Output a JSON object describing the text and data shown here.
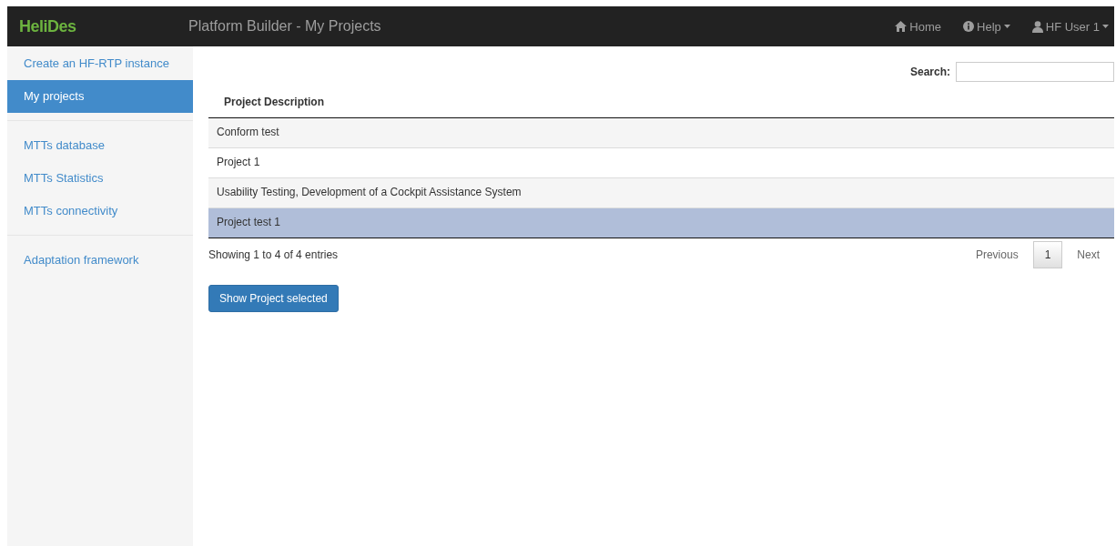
{
  "navbar": {
    "brand": "HeliDes",
    "title": "Platform Builder - My Projects",
    "links": [
      {
        "kind": "home",
        "label": "Home",
        "dropdown": false
      },
      {
        "kind": "help",
        "label": "Help",
        "dropdown": true
      },
      {
        "kind": "user",
        "label": "HF User 1",
        "dropdown": true
      }
    ]
  },
  "sidebar": {
    "groups": [
      [
        {
          "label": "Create an HF-RTP instance",
          "selected": false
        },
        {
          "label": "My projects",
          "selected": true
        }
      ],
      [
        {
          "label": "MTTs database",
          "selected": false
        },
        {
          "label": "MTTs Statistics",
          "selected": false
        },
        {
          "label": "MTTs connectivity",
          "selected": false
        }
      ],
      [
        {
          "label": "Adaptation framework",
          "selected": false
        }
      ]
    ]
  },
  "search": {
    "label": "Search:"
  },
  "table": {
    "columns": [
      "Project Description"
    ],
    "rows": [
      {
        "cells": [
          "Conform test"
        ],
        "selected": false
      },
      {
        "cells": [
          "Project 1"
        ],
        "selected": false
      },
      {
        "cells": [
          "Usability Testing, Development of a Cockpit Assistance System"
        ],
        "selected": false
      },
      {
        "cells": [
          "Project test 1"
        ],
        "selected": true
      }
    ]
  },
  "info": "Showing 1 to 4 of 4 entries",
  "pagination": [
    {
      "label": "Previous",
      "selected": false
    },
    {
      "label": "1",
      "selected": true
    },
    {
      "label": "Next",
      "selected": false
    }
  ],
  "button": "Show Project selected"
}
